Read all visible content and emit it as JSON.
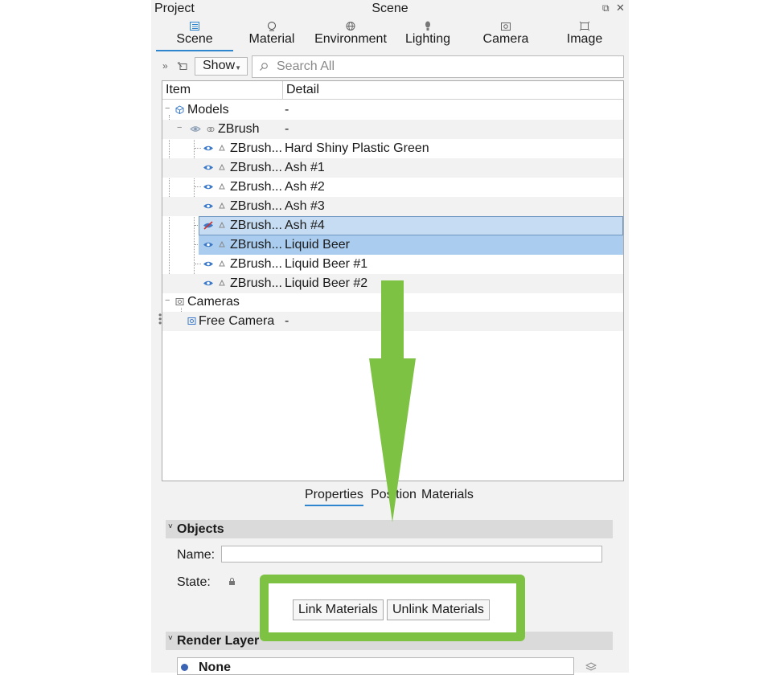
{
  "window": {
    "left_title": "Project",
    "center_title": "Scene"
  },
  "tabs": [
    {
      "label": "Scene",
      "icon": "scene-icon",
      "active": true
    },
    {
      "label": "Material",
      "icon": "material-icon",
      "active": false
    },
    {
      "label": "Environment",
      "icon": "environment-icon",
      "active": false
    },
    {
      "label": "Lighting",
      "icon": "lighting-icon",
      "active": false
    },
    {
      "label": "Camera",
      "icon": "camera-icon",
      "active": false
    },
    {
      "label": "Image",
      "icon": "image-icon",
      "active": false
    }
  ],
  "toolbar": {
    "show_label": "Show",
    "search_placeholder": "Search All"
  },
  "tree": {
    "columns": {
      "item": "Item",
      "detail": "Detail"
    },
    "rows": [
      {
        "item": "Models",
        "detail": "-"
      },
      {
        "item": "ZBrush",
        "detail": "-"
      },
      {
        "item": "ZBrush...",
        "detail": "Hard Shiny Plastic Green"
      },
      {
        "item": "ZBrush...",
        "detail": "Ash #1"
      },
      {
        "item": "ZBrush...",
        "detail": "Ash #2"
      },
      {
        "item": "ZBrush...",
        "detail": "Ash #3"
      },
      {
        "item": "ZBrush...",
        "detail": "Ash #4"
      },
      {
        "item": "ZBrush...",
        "detail": "Liquid Beer"
      },
      {
        "item": "ZBrush...",
        "detail": "Liquid Beer #1"
      },
      {
        "item": "ZBrush...",
        "detail": "Liquid Beer #2"
      },
      {
        "item": "Cameras",
        "detail": ""
      },
      {
        "item": "Free Camera",
        "detail": "-"
      }
    ]
  },
  "subtabs": [
    {
      "label": "Properties",
      "active": true
    },
    {
      "label": "Position",
      "active": false
    },
    {
      "label": "Materials",
      "active": false
    }
  ],
  "objects": {
    "title": "Objects",
    "name_label": "Name:",
    "name_value": "",
    "state_label": "State:",
    "link_label": "Link Materials",
    "unlink_label": "Unlink Materials"
  },
  "render_layer": {
    "title": "Render Layer",
    "value": "None"
  },
  "colors": {
    "highlight": "#7dc242",
    "accent": "#2f86cf",
    "selection": "#aacdef"
  }
}
